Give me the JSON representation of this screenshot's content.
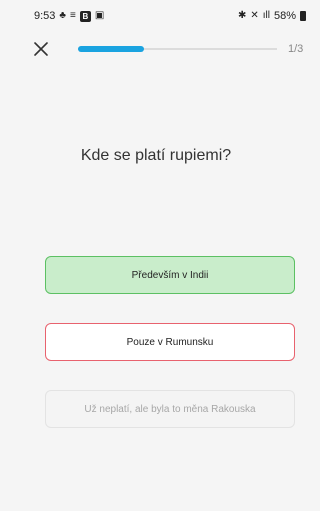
{
  "status_bar": {
    "time": "9:53",
    "battery": "58%",
    "left_icons": [
      "alarm-icon",
      "menu-lines-icon",
      "b-app-icon",
      "image-icon"
    ],
    "right_icons": [
      "bluetooth-icon",
      "mute-icon",
      "signal-icon",
      "battery-icon"
    ]
  },
  "quiz": {
    "progress_text": "1/3",
    "progress_fraction": 0.33,
    "question": "Kde se platí rupiemi?",
    "answers": [
      {
        "label": "Především v Indii",
        "state": "correct"
      },
      {
        "label": "Pouze v Rumunsku",
        "state": "wrong"
      },
      {
        "label": "Už neplatí, ale byla to měna Rakouska",
        "state": "neutral"
      }
    ]
  },
  "colors": {
    "accent": "#1aa3e0",
    "correct_bg": "#c9edcb",
    "correct_border": "#5cc063",
    "wrong_border": "#e8626e",
    "background": "#f5f5f5"
  }
}
